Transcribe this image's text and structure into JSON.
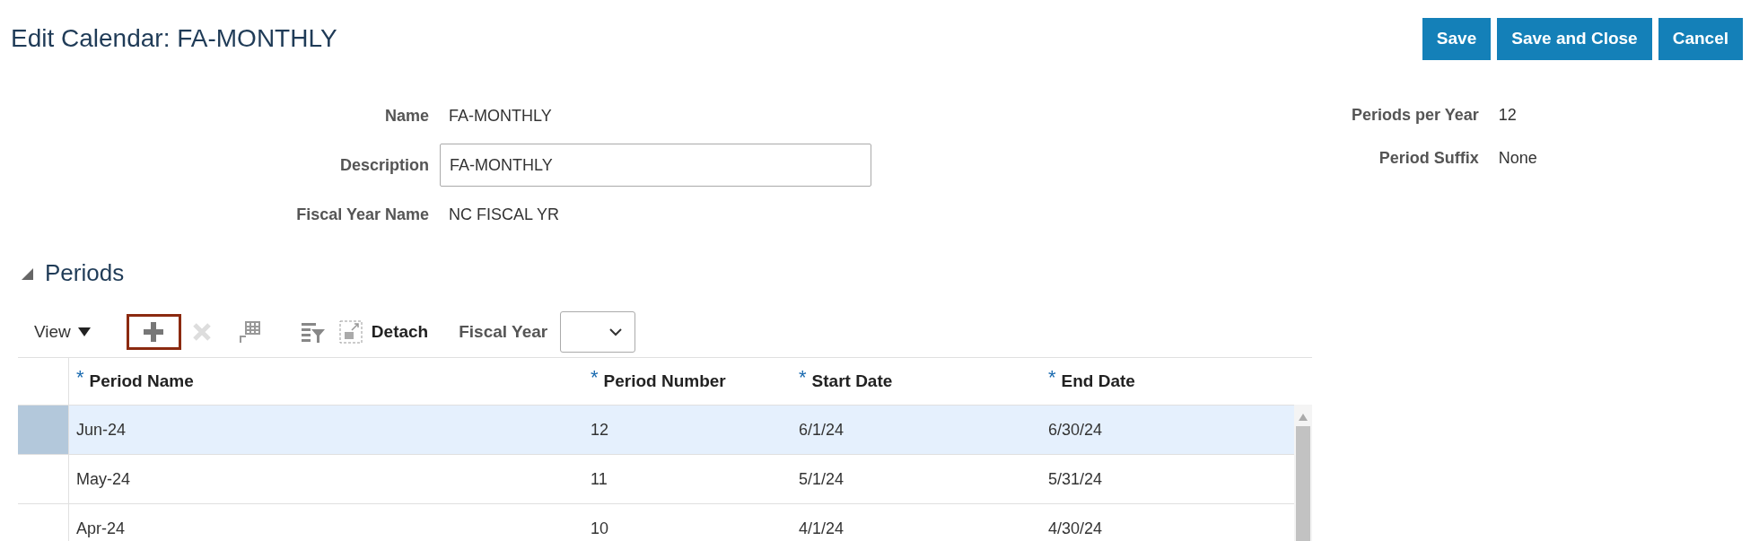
{
  "page_title": "Edit Calendar: FA-MONTHLY",
  "buttons": [
    {
      "label": "Save"
    },
    {
      "label": "Save and Close"
    },
    {
      "label": "Cancel"
    }
  ],
  "form_left": [
    {
      "label": "Name",
      "value": "FA-MONTHLY",
      "kind": "text"
    },
    {
      "label": "Description",
      "value": "FA-MONTHLY",
      "kind": "input"
    },
    {
      "label": "Fiscal Year Name",
      "value": "NC FISCAL YR",
      "kind": "text"
    }
  ],
  "form_right": [
    {
      "label": "Periods per Year",
      "value": "12"
    },
    {
      "label": "Period Suffix",
      "value": "None"
    }
  ],
  "section": {
    "title": "Periods",
    "expanded": true
  },
  "toolbar": {
    "view_label": "View",
    "detach_label": "Detach",
    "fiscal_year_label": "Fiscal Year",
    "add_highlighted": true
  },
  "table": {
    "columns": [
      {
        "label": "Period Name",
        "required_mark": "*"
      },
      {
        "label": "Period Number",
        "required_mark": "*"
      },
      {
        "label": "Start Date",
        "required_mark": "*"
      },
      {
        "label": "End Date",
        "required_mark": "*"
      }
    ],
    "rows": [
      {
        "cells": [
          "Jun-24",
          "12",
          "6/1/24",
          "6/30/24"
        ],
        "selected": true
      },
      {
        "cells": [
          "May-24",
          "11",
          "5/1/24",
          "5/31/24"
        ],
        "selected": false
      },
      {
        "cells": [
          "Apr-24",
          "10",
          "4/1/24",
          "4/30/24"
        ],
        "selected": false
      }
    ]
  }
}
